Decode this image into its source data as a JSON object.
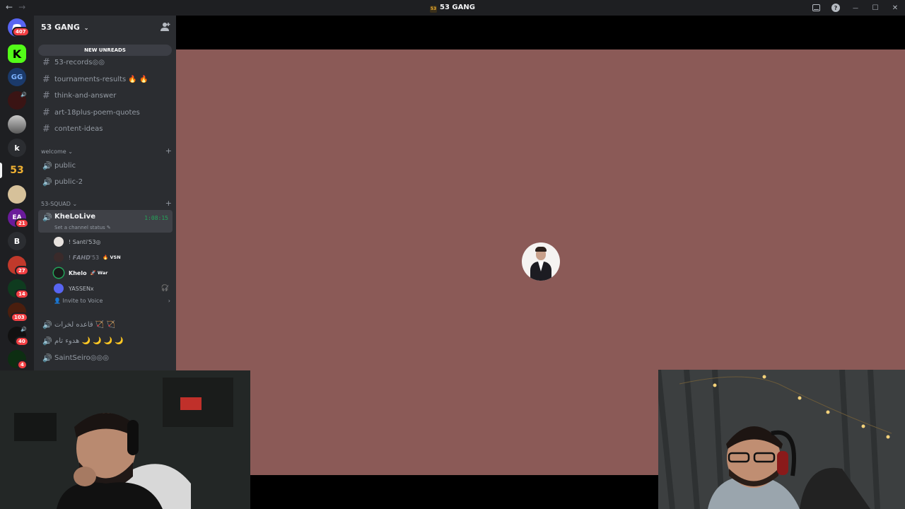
{
  "window": {
    "title": "53 GANG",
    "back_glyph": "←",
    "forward_glyph": "→",
    "help_glyph": "?",
    "minimize_glyph": "—",
    "maximize_glyph": "☐",
    "close_glyph": "✕"
  },
  "servers": [
    {
      "label": "",
      "badge": "407"
    },
    {
      "label": "K",
      "badge": ""
    },
    {
      "label": "",
      "badge": ""
    },
    {
      "label": "",
      "badge": ""
    },
    {
      "label": "",
      "badge": ""
    },
    {
      "label": "k",
      "badge": ""
    },
    {
      "label": "53",
      "badge": ""
    },
    {
      "label": "",
      "badge": ""
    },
    {
      "label": "EA",
      "badge": "21"
    },
    {
      "label": "B",
      "badge": ""
    },
    {
      "label": "",
      "badge": "27"
    },
    {
      "label": "",
      "badge": "14"
    },
    {
      "label": "",
      "badge": "103"
    },
    {
      "label": "",
      "badge": "40"
    },
    {
      "label": "",
      "badge": "4"
    }
  ],
  "sidebar": {
    "server_name": "53 GANG",
    "server_chevron": "⌄",
    "new_unreads": "NEW UNREADS",
    "text_channels": [
      {
        "name": "53-records◎◎"
      },
      {
        "name": "tournaments-results 🔥 🔥"
      },
      {
        "name": "think-and-answer"
      },
      {
        "name": "art-18plus-poem-quotes"
      },
      {
        "name": "content-ideas"
      }
    ],
    "categories": {
      "welcome": "welcome",
      "squad": "53-SQUAD",
      "chevron": "⌄",
      "plus": "+"
    },
    "welcome_voice": [
      {
        "name": "public"
      },
      {
        "name": "public-2"
      }
    ],
    "active_channel": {
      "name": "KheLoLive",
      "timer": "1:08:15",
      "status_prompt": "Set a channel status ✎"
    },
    "voice_users": [
      {
        "name": "! Santi'53◎",
        "tag": ""
      },
      {
        "name": "! 𝙁𝘼𝙃𝘿'53",
        "tag": "🔥 VSN"
      },
      {
        "name": "Khelo",
        "tag": "🚀 War"
      },
      {
        "name": "YASSENx",
        "tag": ""
      }
    ],
    "invite_label": "Invite to Voice",
    "invite_chevron": "›",
    "other_voice": [
      {
        "name": "قاعده لخرات 🏹 🏹"
      },
      {
        "name": "هدوء تام 🌙 🌙 🌙 🌙"
      },
      {
        "name": "SaintSeiro◎◎◎"
      }
    ]
  },
  "colors": {
    "stage_bg": "#8b5a57",
    "sidebar_bg": "#2b2d31",
    "rail_bg": "#1e1f22",
    "speaking_green": "#23a55a",
    "badge_red": "#f23f43"
  }
}
